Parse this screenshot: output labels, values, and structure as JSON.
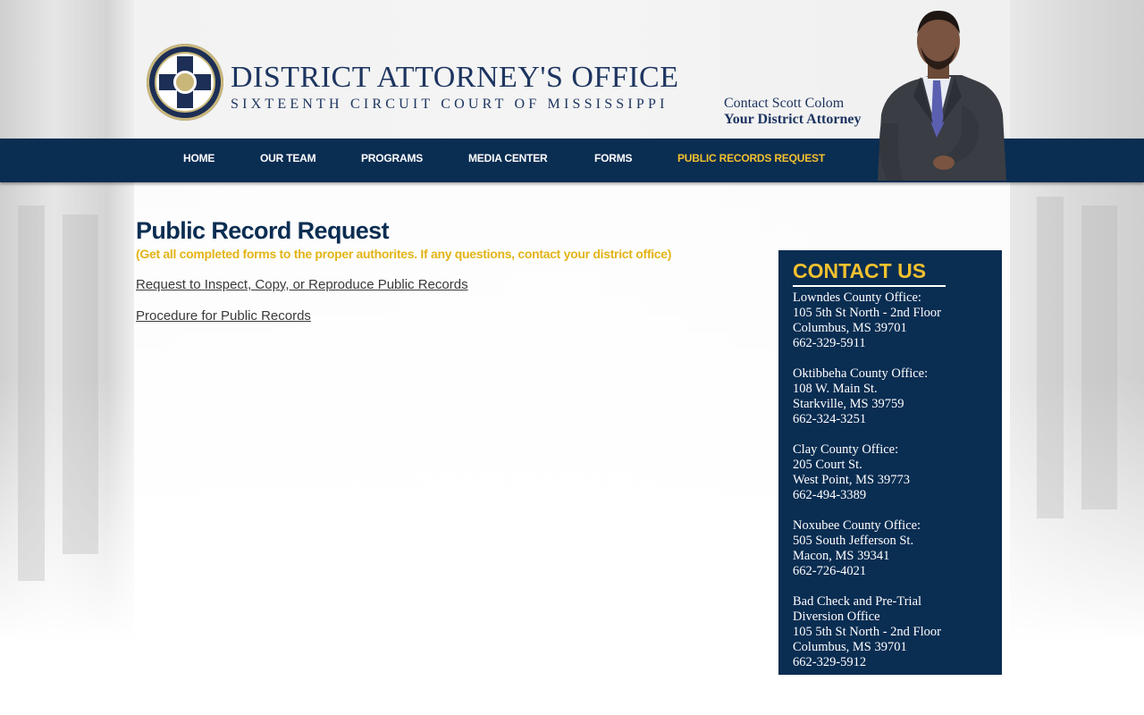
{
  "site": {
    "title": "DISTRICT ATTORNEY'S OFFICE",
    "subtitle": "SIXTEENTH CIRCUIT COURT OF MISSISSIPPI",
    "contact_line1": "Contact Scott Colom",
    "contact_line2": "Your District Attorney"
  },
  "nav": {
    "items": [
      {
        "label": "HOME"
      },
      {
        "label": "OUR TEAM"
      },
      {
        "label": "PROGRAMS"
      },
      {
        "label": "MEDIA CENTER"
      },
      {
        "label": "FORMS"
      },
      {
        "label": "PUBLIC RECORDS REQUEST",
        "active": true
      }
    ]
  },
  "main": {
    "title": "Public Record Request",
    "subtitle": "(Get all completed forms to the proper authorites. If any questions, contact your district office)",
    "links": [
      {
        "label": "Request to Inspect, Copy, or Reproduce Public Records"
      },
      {
        "label": "Procedure for Public Records"
      }
    ]
  },
  "contact": {
    "heading": "CONTACT US",
    "offices": [
      {
        "lines": [
          "Lowndes County Office:",
          "105 5th St North - 2nd Floor",
          "Columbus, MS 39701",
          "662-329-5911"
        ]
      },
      {
        "lines": [
          "Oktibbeha County Office:",
          "108 W. Main St.",
          "Starkville, MS 39759",
          "662-324-3251"
        ]
      },
      {
        "lines": [
          "Clay County Office:",
          "205 Court St.",
          "West Point, MS 39773",
          "662-494-3389"
        ]
      },
      {
        "lines": [
          "Noxubee County Office:",
          "505 South Jefferson St.",
          "Macon, MS 39341",
          "662-726-4021"
        ]
      },
      {
        "lines": [
          "Bad Check and Pre-Trial",
          "Diversion Office",
          "105 5th St North - 2nd Floor",
          "Columbus, MS 39701",
          "662-329-5912"
        ]
      }
    ]
  },
  "colors": {
    "navy": "#0a2d52",
    "gold": "#f2c12e",
    "title_blue": "#1d3560"
  },
  "icons": {
    "seal": "district-attorney-seal-icon",
    "portrait": "district-attorney-portrait"
  }
}
